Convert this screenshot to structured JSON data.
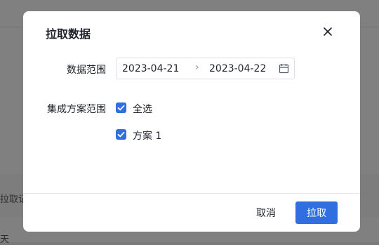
{
  "background": {
    "text_1": "拉取记",
    "text_2": "天"
  },
  "dialog": {
    "title": "拉取数据",
    "close_icon": "close-icon",
    "data_range": {
      "label": "数据范围",
      "start": "2023-04-21",
      "separator": "›",
      "end": "2023-04-22",
      "icon": "calendar-icon"
    },
    "scheme_range": {
      "label": "集成方案范围",
      "options": [
        {
          "label": "全选",
          "checked": true
        },
        {
          "label": "方案 1",
          "checked": true
        }
      ]
    },
    "footer": {
      "cancel_label": "取消",
      "ok_label": "拉取"
    }
  },
  "colors": {
    "primary": "#2f6fdf",
    "overlay": "#808080",
    "text": "#1d2129"
  }
}
